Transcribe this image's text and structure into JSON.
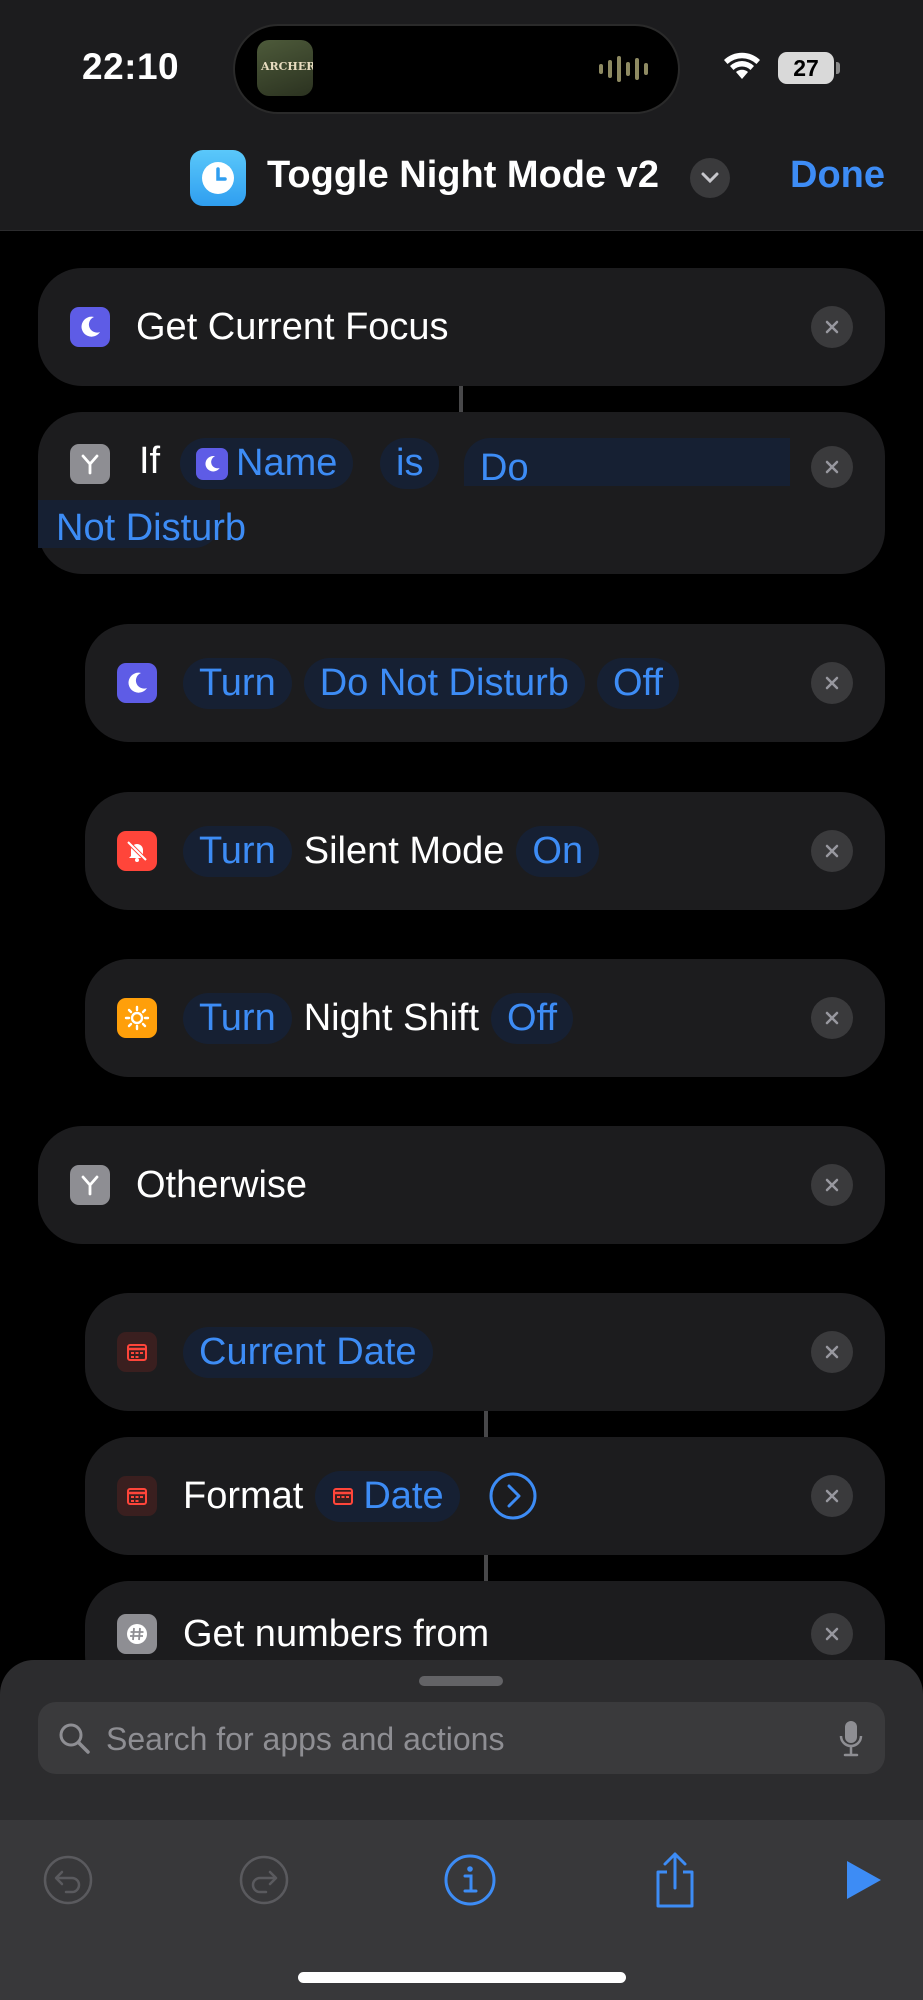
{
  "status": {
    "time": "22:10",
    "battery": "27",
    "album_art_text": "ARCHERS"
  },
  "nav": {
    "title": "Toggle Night Mode v2",
    "done": "Done"
  },
  "actions": {
    "get_focus": {
      "label": "Get Current Focus"
    },
    "if_block": {
      "if": "If",
      "var": "Name",
      "op": "is",
      "value": "Do Not Disturb"
    },
    "dnd": {
      "turn": "Turn",
      "target": "Do Not Disturb",
      "state": "Off"
    },
    "silent": {
      "turn": "Turn",
      "target": "Silent Mode",
      "state": "On"
    },
    "night_shift": {
      "turn": "Turn",
      "target": "Night Shift",
      "state": "Off"
    },
    "otherwise": {
      "label": "Otherwise"
    },
    "current_date": {
      "token": "Current Date"
    },
    "format": {
      "label": "Format",
      "token": "Date"
    },
    "get_numbers": {
      "label": "Get numbers from"
    }
  },
  "search": {
    "placeholder": "Search for apps and actions"
  },
  "colors": {
    "accent": "#3d8cf5",
    "focus_purple": "#5e5ce6",
    "silent_red": "#ff453a",
    "night_orange": "#ff9f0a",
    "scripting_gray": "#8e8e93"
  }
}
